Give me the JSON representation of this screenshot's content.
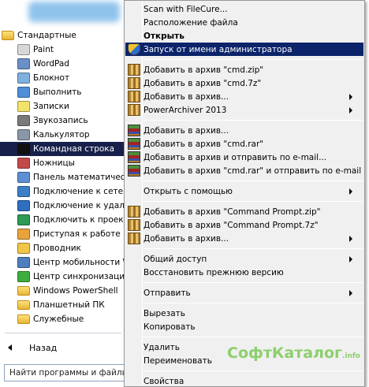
{
  "start_menu": {
    "programs": [
      {
        "label": "Стандартные",
        "icon": "folder-icon",
        "level": 0,
        "color": "#f4c542"
      },
      {
        "label": "Paint",
        "icon": "paint-icon",
        "level": 1,
        "color": "#d8d8d8"
      },
      {
        "label": "WordPad",
        "icon": "wordpad-icon",
        "level": 1,
        "color": "#6a8fc9"
      },
      {
        "label": "Блокнот",
        "icon": "notepad-icon",
        "level": 1,
        "color": "#7fb0e0"
      },
      {
        "label": "Выполнить",
        "icon": "run-icon",
        "level": 1,
        "color": "#4f8fd8"
      },
      {
        "label": "Записки",
        "icon": "sticky-notes-icon",
        "level": 1,
        "color": "#f2e46a"
      },
      {
        "label": "Звукозапись",
        "icon": "microphone-icon",
        "level": 1,
        "color": "#7a7a7a"
      },
      {
        "label": "Калькулятор",
        "icon": "calculator-icon",
        "level": 1,
        "color": "#8a97a8"
      },
      {
        "label": "Командная строка",
        "icon": "command-prompt-icon",
        "level": 1,
        "color": "#111111",
        "selected": true
      },
      {
        "label": "Ножницы",
        "icon": "scissors-icon",
        "level": 1,
        "color": "#c44a4a"
      },
      {
        "label": "Панель математическ",
        "icon": "math-panel-icon",
        "level": 1,
        "color": "#5d8fd2"
      },
      {
        "label": "Подключение к сетево",
        "icon": "network-projector-icon",
        "level": 1,
        "color": "#3d7fc7"
      },
      {
        "label": "Подключение к удале",
        "icon": "remote-desktop-icon",
        "level": 1,
        "color": "#2f6fbf"
      },
      {
        "label": "Подключить к проект",
        "icon": "projector-icon",
        "level": 1,
        "color": "#2e9a55"
      },
      {
        "label": "Приступая к работе",
        "icon": "getting-started-icon",
        "level": 1,
        "color": "#e8a33c"
      },
      {
        "label": "Проводник",
        "icon": "explorer-icon",
        "level": 1,
        "color": "#f0c64a"
      },
      {
        "label": "Центр мобильности W",
        "icon": "mobility-center-icon",
        "level": 1,
        "color": "#4d7fbe"
      },
      {
        "label": "Центр синхронизации",
        "icon": "sync-center-icon",
        "level": 1,
        "color": "#3fae3f"
      },
      {
        "label": "Windows PowerShell",
        "icon": "folder-icon",
        "level": 1,
        "color": "#f4c542"
      },
      {
        "label": "Планшетный ПК",
        "icon": "folder-icon",
        "level": 1,
        "color": "#f4c542"
      },
      {
        "label": "Служебные",
        "icon": "folder-icon",
        "level": 1,
        "color": "#f4c542"
      }
    ],
    "back_label": "Назад",
    "search_placeholder": "Найти программы и файлы"
  },
  "context_menu": {
    "items": [
      {
        "type": "item",
        "label": "Scan with FileCure...",
        "icon": ""
      },
      {
        "type": "item",
        "label": "Расположение файла",
        "icon": ""
      },
      {
        "type": "item",
        "label": "Открыть",
        "icon": "",
        "bold": true
      },
      {
        "type": "item",
        "label": "Запуск от имени администратора",
        "icon": "uac-shield-icon",
        "selected": true
      },
      {
        "type": "separator"
      },
      {
        "type": "item",
        "label": "Добавить в архив \"cmd.zip\"",
        "icon": "7zip-icon"
      },
      {
        "type": "item",
        "label": "Добавить в архив \"cmd.7z\"",
        "icon": "7zip-icon"
      },
      {
        "type": "item",
        "label": "Добавить в архив...",
        "icon": "7zip-icon",
        "submenu": true
      },
      {
        "type": "item",
        "label": "PowerArchiver 2013",
        "icon": "7zip-icon",
        "submenu": true
      },
      {
        "type": "separator"
      },
      {
        "type": "item",
        "label": "Добавить в архив...",
        "icon": "winrar-icon"
      },
      {
        "type": "item",
        "label": "Добавить в архив \"cmd.rar\"",
        "icon": "winrar-icon"
      },
      {
        "type": "item",
        "label": "Добавить в архив и отправить по e-mail...",
        "icon": "winrar-icon"
      },
      {
        "type": "item",
        "label": "Добавить в архив \"cmd.rar\" и отправить по e-mail",
        "icon": "winrar-icon"
      },
      {
        "type": "separator"
      },
      {
        "type": "item",
        "label": "Открыть с помощью",
        "icon": "",
        "submenu": true
      },
      {
        "type": "separator"
      },
      {
        "type": "item",
        "label": "Добавить в архив \"Command Prompt.zip\"",
        "icon": "7zip-icon"
      },
      {
        "type": "item",
        "label": "Добавить в архив \"Command Prompt.7z\"",
        "icon": "7zip-icon"
      },
      {
        "type": "item",
        "label": "Добавить в архив...",
        "icon": "7zip-icon",
        "submenu": true
      },
      {
        "type": "separator"
      },
      {
        "type": "item",
        "label": "Общий доступ",
        "icon": "",
        "submenu": true
      },
      {
        "type": "item",
        "label": "Восстановить прежнюю версию",
        "icon": ""
      },
      {
        "type": "separator"
      },
      {
        "type": "item",
        "label": "Отправить",
        "icon": "",
        "submenu": true
      },
      {
        "type": "separator"
      },
      {
        "type": "item",
        "label": "Вырезать",
        "icon": ""
      },
      {
        "type": "item",
        "label": "Копировать",
        "icon": ""
      },
      {
        "type": "separator"
      },
      {
        "type": "item",
        "label": "Удалить",
        "icon": ""
      },
      {
        "type": "item",
        "label": "Переименовать",
        "icon": ""
      },
      {
        "type": "separator"
      },
      {
        "type": "item",
        "label": "Свойства",
        "icon": ""
      }
    ]
  },
  "watermark": {
    "text": "СофтКаталог",
    "suffix": ".info"
  }
}
